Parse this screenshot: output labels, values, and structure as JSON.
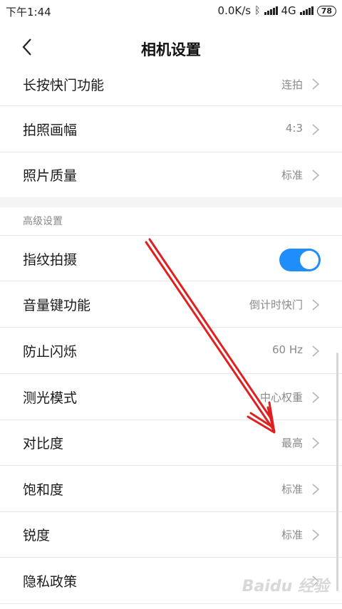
{
  "status": {
    "time": "下午1:44",
    "speed": "0.0K/s",
    "network": "4G",
    "battery": "78"
  },
  "nav": {
    "title": "相机设置"
  },
  "rows_top": [
    {
      "label": "长按快门功能",
      "value": "连拍"
    },
    {
      "label": "拍照画幅",
      "value": "4:3"
    },
    {
      "label": "照片质量",
      "value": "标准"
    }
  ],
  "section": {
    "title": "高级设置"
  },
  "fingerprint": {
    "label": "指纹拍摄",
    "enabled": true
  },
  "rows_adv": [
    {
      "label": "音量键功能",
      "value": "倒计时快门"
    },
    {
      "label": "防止闪烁",
      "value": "60 Hz"
    },
    {
      "label": "测光模式",
      "value": "中心权重"
    },
    {
      "label": "对比度",
      "value": "最高"
    },
    {
      "label": "饱和度",
      "value": "标准"
    },
    {
      "label": "锐度",
      "value": "标准"
    },
    {
      "label": "隐私政策",
      "value": ""
    }
  ],
  "watermark": "Baidu 经验",
  "colors": {
    "accent": "#1f8efa",
    "arrow": "#e02020"
  }
}
